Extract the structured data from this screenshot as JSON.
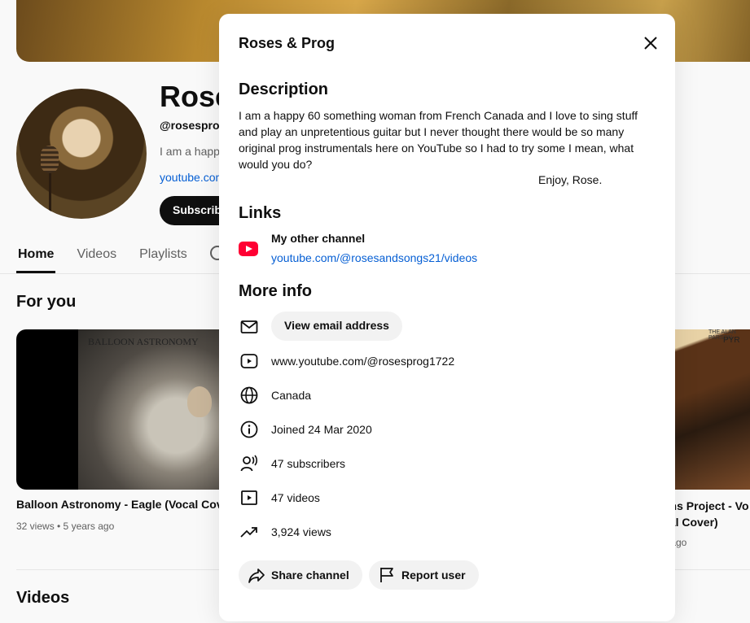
{
  "channel": {
    "name_partial": "Rose",
    "handle_partial": "@rosesprog",
    "description_partial": "I am a happ",
    "link_partial": "youtube.com",
    "subscribe_label": "Subscribe"
  },
  "tabs": [
    {
      "label": "Home",
      "active": true
    },
    {
      "label": "Videos",
      "active": false
    },
    {
      "label": "Playlists",
      "active": false
    }
  ],
  "sections": {
    "for_you": "For you",
    "videos": "Videos"
  },
  "videos": [
    {
      "title": "Balloon Astronomy - Eagle (Vocal Cover)",
      "meta": "32 views • 5 years ago",
      "thumb_text": "BALLOON ASTRONOMY"
    },
    {
      "title": "ons Project - Vo cal Cover)",
      "meta": "s ago",
      "thumb_text_1": "THE ALAN PARSON",
      "thumb_text_2": "PYR"
    }
  ],
  "dialog": {
    "title": "Roses & Prog",
    "description_heading": "Description",
    "description": "I am a happy 60 something woman from French Canada and I love to sing stuff and play an unpretentious guitar but I never thought there would be so many original prog instrumentals here on YouTube so I had to try some I mean, what would you do?",
    "signoff": "Enjoy, Rose.",
    "links_heading": "Links",
    "link": {
      "label": "My other channel",
      "url": "youtube.com/@rosesandsongs21/videos",
      "icon": "youtube-icon"
    },
    "more_info_heading": "More info",
    "email_button": "View email address",
    "info": [
      {
        "icon": "play-circle-icon",
        "text": "www.youtube.com/@rosesprog1722"
      },
      {
        "icon": "globe-icon",
        "text": "Canada"
      },
      {
        "icon": "info-icon",
        "text": "Joined 24 Mar 2020"
      },
      {
        "icon": "subscribers-icon",
        "text": "47 subscribers"
      },
      {
        "icon": "video-icon",
        "text": "47 videos"
      },
      {
        "icon": "trending-icon",
        "text": "3,924 views"
      }
    ],
    "share_label": "Share channel",
    "report_label": "Report user"
  },
  "colors": {
    "link": "#065fd4",
    "youtube_red": "#ff0033",
    "button_bg": "#f2f2f2"
  }
}
